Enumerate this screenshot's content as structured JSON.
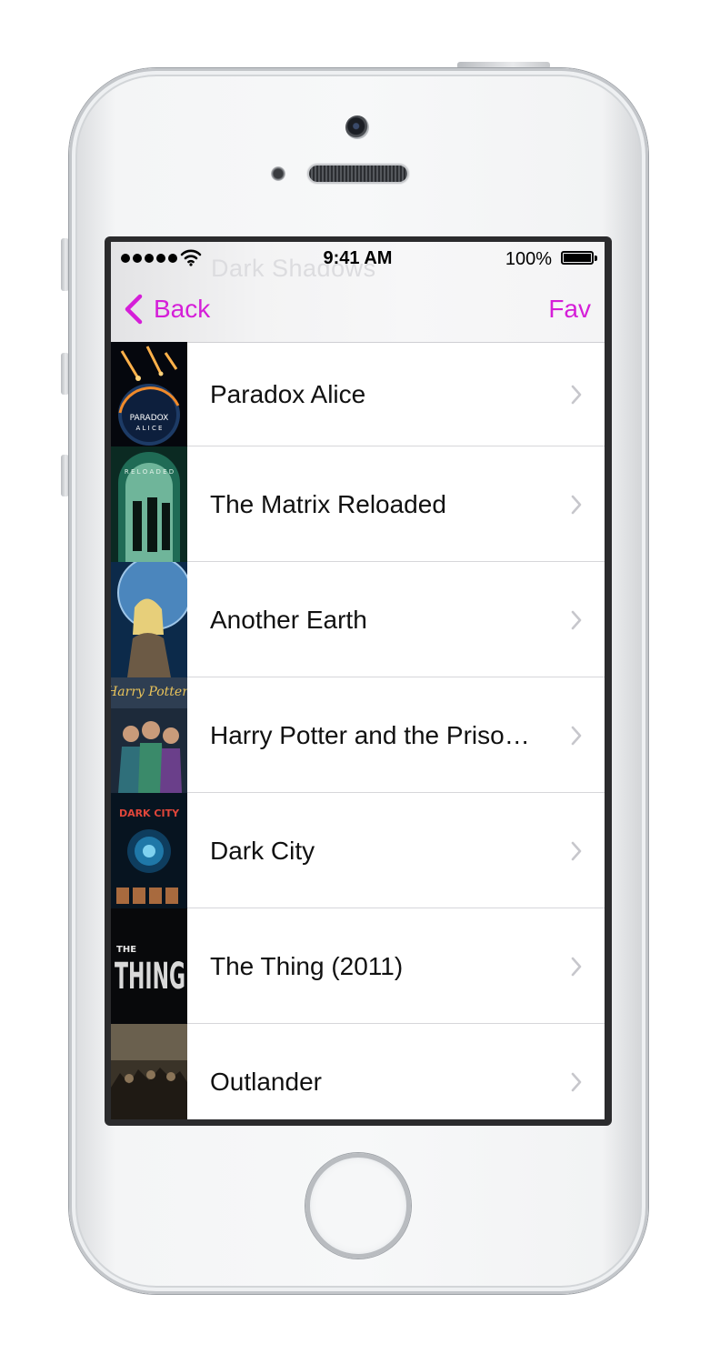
{
  "status_bar": {
    "time": "9:41 AM",
    "battery": "100%",
    "signal_bars": 5
  },
  "navbar": {
    "back_label": "Back",
    "faded_title": "Dark Shadows",
    "right_label": "Fav",
    "accent_color": "#d51ed8"
  },
  "movies": [
    {
      "title": "Paradox Alice",
      "poster_icon": "paradox-alice-poster"
    },
    {
      "title": "The Matrix Reloaded",
      "poster_icon": "matrix-reloaded-poster"
    },
    {
      "title": "Another Earth",
      "poster_icon": "another-earth-poster"
    },
    {
      "title": "Harry Potter and the Prisoner of Azkaban",
      "poster_icon": "harry-potter-poster"
    },
    {
      "title": "Dark City",
      "poster_icon": "dark-city-poster"
    },
    {
      "title": "The Thing (2011)",
      "poster_icon": "the-thing-poster"
    },
    {
      "title": "Outlander",
      "poster_icon": "outlander-poster"
    }
  ]
}
